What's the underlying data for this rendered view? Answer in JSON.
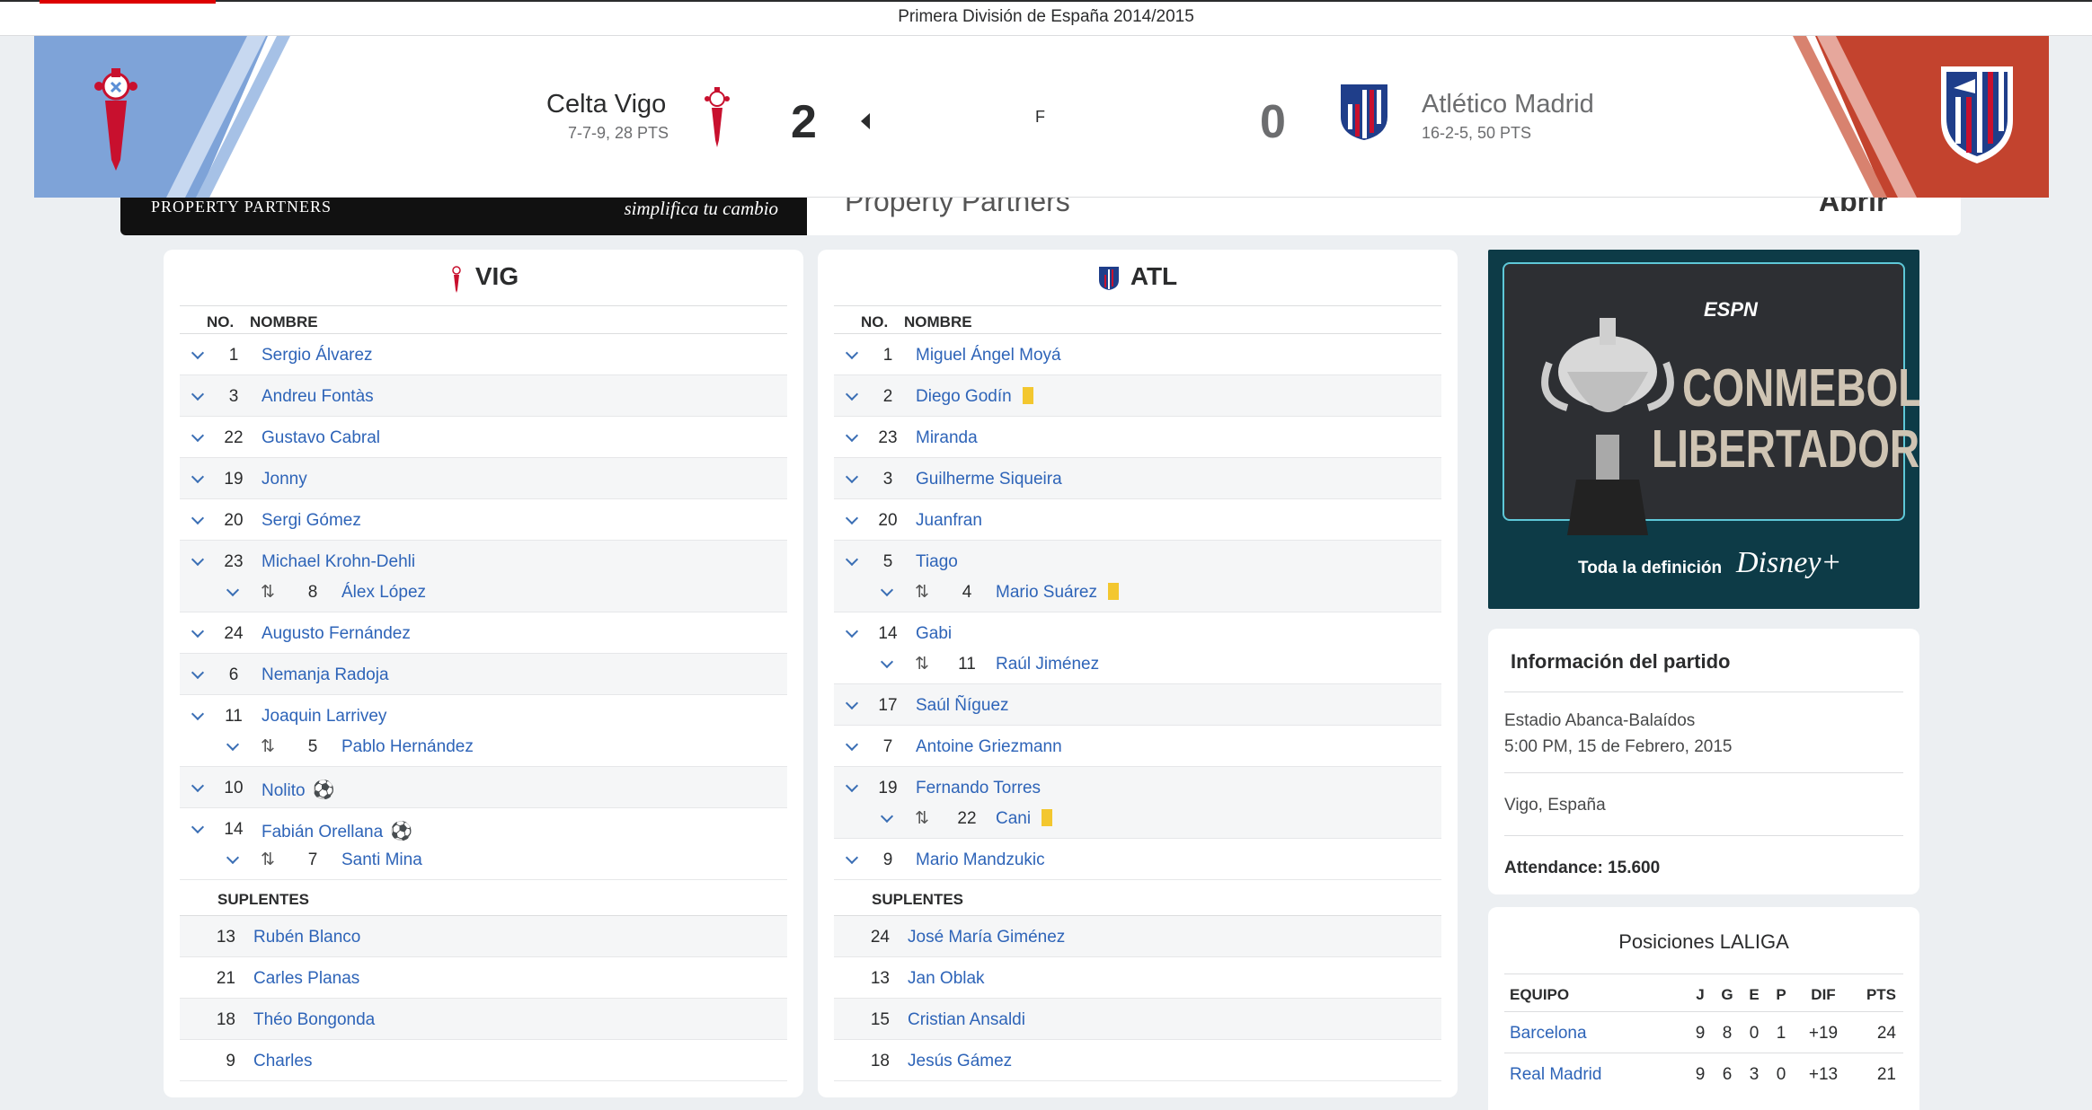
{
  "league": "Primera División de España 2014/2015",
  "match": {
    "home": {
      "name": "Celta Vigo",
      "record": "7-7-9, 28 PTS",
      "score": "2",
      "color": "#7ea3d8"
    },
    "away": {
      "name": "Atlético Madrid",
      "record": "16-2-5, 50 PTS",
      "score": "0",
      "color": "#c3432e"
    },
    "status": "F"
  },
  "ad": {
    "brand": "PROPERTY PARTNERS",
    "slogan": "simplifica tu cambio",
    "title": "Property Partners",
    "cta": "Abrir"
  },
  "lineups": {
    "no_label": "NO.",
    "name_label": "NOMBRE",
    "subs_label": "SUPLENTES",
    "home": {
      "abbr": "VIG",
      "starters": [
        {
          "no": "1",
          "name": "Sergio Álvarez"
        },
        {
          "no": "3",
          "name": "Andreu Fontàs"
        },
        {
          "no": "22",
          "name": "Gustavo Cabral"
        },
        {
          "no": "19",
          "name": "Jonny"
        },
        {
          "no": "20",
          "name": "Sergi Gómez"
        },
        {
          "no": "23",
          "name": "Michael Krohn-Dehli",
          "sub_no": "8",
          "sub_name": "Álex López"
        },
        {
          "no": "24",
          "name": "Augusto Fernández"
        },
        {
          "no": "6",
          "name": "Nemanja Radoja"
        },
        {
          "no": "11",
          "name": "Joaquin Larrivey",
          "sub_no": "5",
          "sub_name": "Pablo Hernández"
        },
        {
          "no": "10",
          "name": "Nolito",
          "goal": true
        },
        {
          "no": "14",
          "name": "Fabián Orellana",
          "goal": true,
          "sub_no": "7",
          "sub_name": "Santi Mina"
        }
      ],
      "subs": [
        {
          "no": "13",
          "name": "Rubén Blanco"
        },
        {
          "no": "21",
          "name": "Carles Planas"
        },
        {
          "no": "18",
          "name": "Théo Bongonda"
        },
        {
          "no": "9",
          "name": "Charles"
        }
      ]
    },
    "away": {
      "abbr": "ATL",
      "starters": [
        {
          "no": "1",
          "name": "Miguel Ángel Moyá"
        },
        {
          "no": "2",
          "name": "Diego Godín",
          "yellow": true
        },
        {
          "no": "23",
          "name": "Miranda"
        },
        {
          "no": "3",
          "name": "Guilherme Siqueira"
        },
        {
          "no": "20",
          "name": "Juanfran"
        },
        {
          "no": "5",
          "name": "Tiago",
          "sub_no": "4",
          "sub_name": "Mario Suárez",
          "sub_yellow": true
        },
        {
          "no": "14",
          "name": "Gabi",
          "sub_no": "11",
          "sub_name": "Raúl Jiménez"
        },
        {
          "no": "17",
          "name": "Saúl Ñíguez"
        },
        {
          "no": "7",
          "name": "Antoine Griezmann"
        },
        {
          "no": "19",
          "name": "Fernando Torres",
          "sub_no": "22",
          "sub_name": "Cani",
          "sub_yellow": true
        },
        {
          "no": "9",
          "name": "Mario Mandzukic"
        }
      ],
      "subs": [
        {
          "no": "24",
          "name": "José María Giménez"
        },
        {
          "no": "13",
          "name": "Jan Oblak"
        },
        {
          "no": "15",
          "name": "Cristian Ansaldi"
        },
        {
          "no": "18",
          "name": "Jesús Gámez"
        }
      ]
    }
  },
  "promo": {
    "network": "ESPN",
    "title1": "CONMEBOL",
    "title2": "LIBERTADORES",
    "tagline": "Toda la definición",
    "service": "Disney+"
  },
  "info": {
    "title": "Información del partido",
    "stadium": "Estadio Abanca-Balaídos",
    "datetime": "5:00 PM, 15 de Febrero, 2015",
    "city": "Vigo, España",
    "attendance": "Attendance: 15.600"
  },
  "standings": {
    "title": "Posiciones LALIGA",
    "headers": [
      "EQUIPO",
      "J",
      "G",
      "E",
      "P",
      "DIF",
      "PTS"
    ],
    "rows": [
      [
        "Barcelona",
        "9",
        "8",
        "0",
        "1",
        "+19",
        "24"
      ],
      [
        "Real Madrid",
        "9",
        "6",
        "3",
        "0",
        "+13",
        "21"
      ]
    ]
  }
}
